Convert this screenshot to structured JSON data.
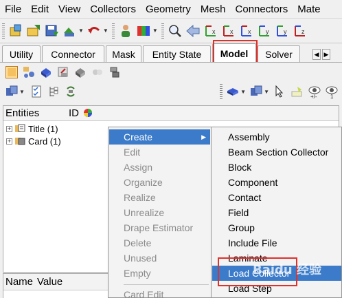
{
  "menubar": {
    "items": [
      "File",
      "Edit",
      "View",
      "Collectors",
      "Geometry",
      "Mesh",
      "Connectors",
      "Mate"
    ]
  },
  "toolbar": {
    "icons": [
      "open-model-icon",
      "import-icon",
      "save-icon",
      "export-icon",
      "undo-icon",
      "redo-icon",
      "user-icon",
      "color-icon",
      "zoom-icon",
      "view-back-icon",
      "view-x-icon",
      "view-y-icon",
      "view-z-icon"
    ]
  },
  "tabs": {
    "items": [
      "Utility",
      "Connector",
      "Mask",
      "Entity State",
      "Model",
      "Solver"
    ],
    "active": "Model"
  },
  "browser": {
    "columns": [
      "Entities",
      "ID"
    ],
    "rows": [
      "Title (1)",
      "Card (1)"
    ]
  },
  "namevalue": {
    "columns": [
      "Name",
      "Value"
    ]
  },
  "context_menu": {
    "items": [
      "Create",
      "Edit",
      "Assign",
      "Organize",
      "Realize",
      "Unrealize",
      "Drape Estimator",
      "Delete",
      "Unused",
      "Empty",
      "Card Edit"
    ],
    "selected": "Create"
  },
  "create_submenu": {
    "items": [
      "Assembly",
      "Beam Section Collector",
      "Block",
      "Component",
      "Contact",
      "Field",
      "Group",
      "Include File",
      "Laminate",
      "Load Collector",
      "Load Step"
    ],
    "selected": "Load Collector"
  },
  "watermark": {
    "text": "Baidu 经验"
  },
  "colors": {
    "highlight_box": "#e0302a",
    "menu_selection": "#3b7bc9"
  }
}
